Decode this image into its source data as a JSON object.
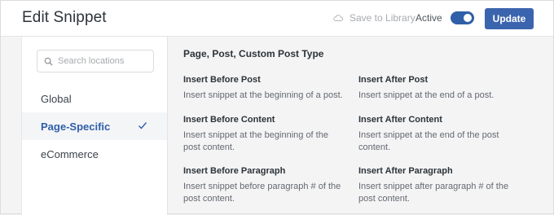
{
  "header": {
    "title": "Edit Snippet",
    "save_to_library": "Save to Library",
    "active_label": "Active",
    "active_toggle_on": true,
    "update_label": "Update"
  },
  "sidebar": {
    "search_placeholder": "Search locations",
    "items": [
      {
        "label": "Global",
        "active": false
      },
      {
        "label": "Page-Specific",
        "active": true
      },
      {
        "label": "eCommerce",
        "active": false
      }
    ]
  },
  "main": {
    "section_title": "Page, Post, Custom Post Type",
    "options": [
      {
        "title": "Insert Before Post",
        "desc": "Insert snippet at the beginning of a post."
      },
      {
        "title": "Insert After Post",
        "desc": "Insert snippet at the end of a post."
      },
      {
        "title": "Insert Before Content",
        "desc": "Insert snippet at the beginning of the post content."
      },
      {
        "title": "Insert After Content",
        "desc": "Insert snippet at the end of the post content."
      },
      {
        "title": "Insert Before Paragraph",
        "desc": "Insert snippet before paragraph # of the post content."
      },
      {
        "title": "Insert After Paragraph",
        "desc": "Insert snippet after paragraph # of the post content."
      }
    ]
  },
  "colors": {
    "accent": "#3b64ae",
    "active_nav": "#2f5fa8"
  }
}
